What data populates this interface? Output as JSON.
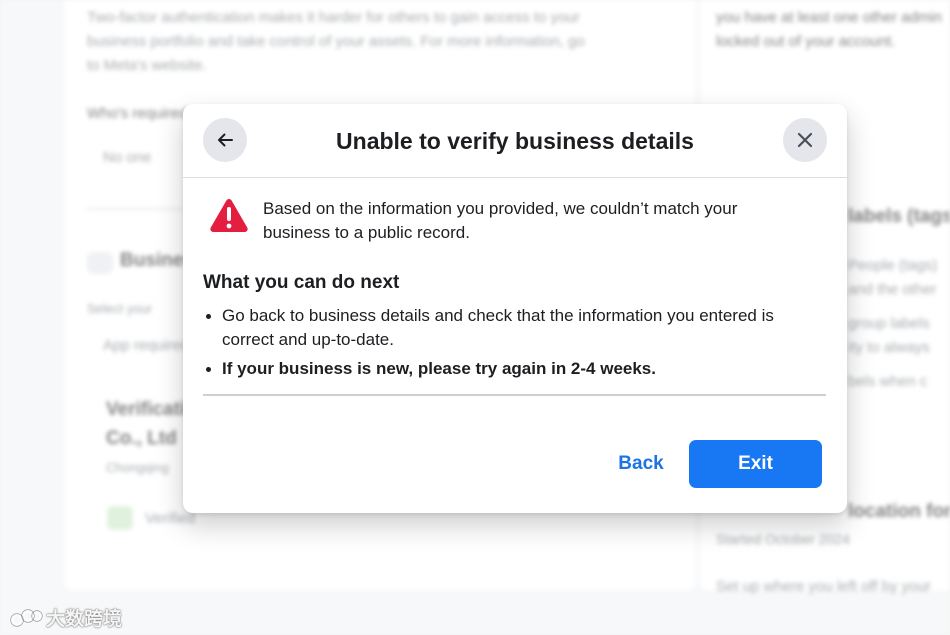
{
  "background": {
    "left_lines": [
      "Two-factor authentication makes it harder for others to gain access to your",
      "business portfolio and take control of your assets. For more information, go",
      "to Meta's website."
    ],
    "who_required_label": "Who's required",
    "who_required_value": "No one",
    "business_heading": "Business",
    "select_label": "Select your",
    "app_required": "App required",
    "verification_name_line1": "Verification",
    "verification_name_line2": "Co., Ltd",
    "verification_location": "Chongqing",
    "verified_label": "Verified",
    "right_lines": [
      "you have at least one other admin",
      "locked out of your account."
    ],
    "right_heading": "labels (tags)",
    "right_text_1": "People (tags)",
    "right_text_2": "and the other",
    "right_text_3": "group labels",
    "right_text_4": "ity to always",
    "right_text_5": "bels when c",
    "right_heading_2": "location for",
    "right_date": "Started October 2024",
    "right_footer": "Set up where you left off by your"
  },
  "modal": {
    "title": "Unable to verify business details",
    "back_icon": "arrow-left-icon",
    "close_icon": "close-icon",
    "alert_icon": "warning-triangle-icon",
    "alert_text": "Based on the information you provided, we couldn’t match your business to a public record.",
    "next_heading": "What you can do next",
    "steps": [
      "Go back to business details and check that the information you entered is correct and up-to-date.",
      "If your business is new, please try again in 2-4 weeks."
    ],
    "back_label": "Back",
    "exit_label": "Exit"
  },
  "watermark": {
    "text": "大数跨境",
    "icon": "watermark-logo-icon"
  },
  "colors": {
    "primary_blue": "#1877f2",
    "link_blue": "#1b74e4",
    "warning_red": "#e41e3f",
    "text_dark": "#1c1e21"
  }
}
